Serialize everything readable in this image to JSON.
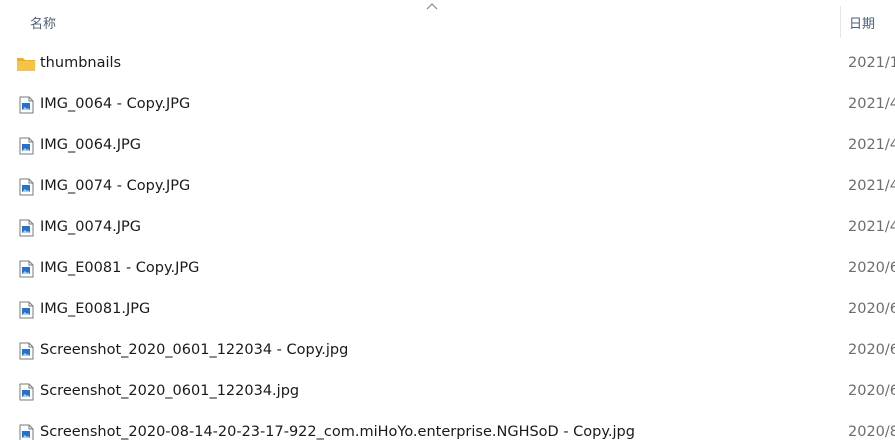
{
  "header": {
    "name_label": "名称",
    "date_label": "日期"
  },
  "files": [
    {
      "name": "thumbnails",
      "type": "folder",
      "date": "2021/1"
    },
    {
      "name": "IMG_0064 - Copy.JPG",
      "type": "image",
      "date": "2021/4"
    },
    {
      "name": "IMG_0064.JPG",
      "type": "image",
      "date": "2021/4"
    },
    {
      "name": "IMG_0074 - Copy.JPG",
      "type": "image",
      "date": "2021/4"
    },
    {
      "name": "IMG_0074.JPG",
      "type": "image",
      "date": "2021/4"
    },
    {
      "name": "IMG_E0081 - Copy.JPG",
      "type": "image",
      "date": "2020/6"
    },
    {
      "name": "IMG_E0081.JPG",
      "type": "image",
      "date": "2020/6"
    },
    {
      "name": "Screenshot_2020_0601_122034 - Copy.jpg",
      "type": "image",
      "date": "2020/6"
    },
    {
      "name": "Screenshot_2020_0601_122034.jpg",
      "type": "image",
      "date": "2020/6"
    },
    {
      "name": "Screenshot_2020-08-14-20-23-17-922_com.miHoYo.enterprise.NGHSoD - Copy.jpg",
      "type": "image",
      "date": "2020/8"
    }
  ],
  "icons": {
    "folder": "folder-icon",
    "image": "image-file-icon",
    "sort": "sort-ascending-icon"
  },
  "colors": {
    "folder": "#f6c342",
    "header_text": "#4c607a",
    "image_accent": "#2a6fc9"
  }
}
